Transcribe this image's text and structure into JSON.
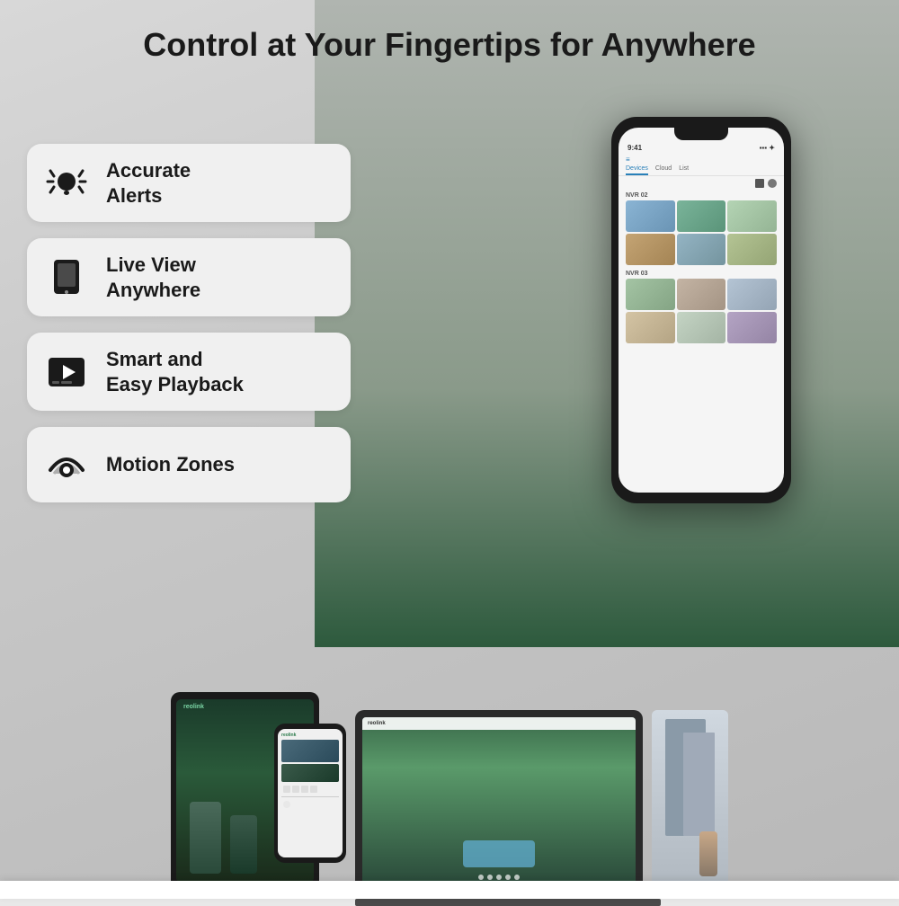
{
  "page": {
    "title": "Control at Your Fingertips for Anywhere",
    "background_color": "#d4d4d4"
  },
  "features": [
    {
      "id": "accurate-alerts",
      "label": "Accurate\nAlerts",
      "icon": "alert-icon"
    },
    {
      "id": "live-view",
      "label": "Live View\nAnywhere",
      "icon": "phone-icon"
    },
    {
      "id": "smart-playback",
      "label": "Smart and\nEasy Playback",
      "icon": "play-icon"
    },
    {
      "id": "motion-zones",
      "label": "Motion Zones",
      "icon": "motion-icon"
    }
  ],
  "phone": {
    "status": "9:41",
    "nav_tabs": [
      "Devices",
      "Cloud",
      "List"
    ],
    "section1": "NVR 02",
    "section2": "NVR 03"
  },
  "devices": {
    "tablet_logo": "reolink",
    "laptop_logo": "reolink",
    "phone_label": "reolink"
  }
}
